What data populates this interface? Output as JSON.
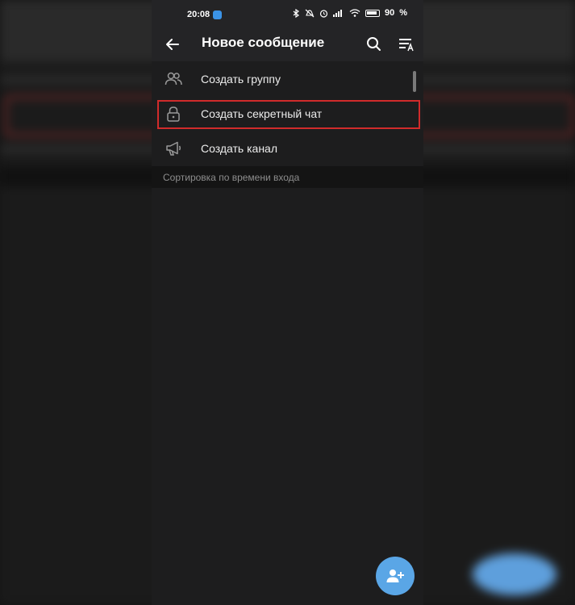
{
  "status_bar": {
    "time": "20:08",
    "battery": "90"
  },
  "app_bar": {
    "title": "Новое сообщение"
  },
  "menu": {
    "items": [
      {
        "label": "Создать группу",
        "icon": "people-icon"
      },
      {
        "label": "Создать секретный чат",
        "icon": "lock-icon"
      },
      {
        "label": "Создать канал",
        "icon": "megaphone-icon"
      }
    ]
  },
  "section": {
    "header": "Сортировка по времени входа"
  },
  "colors": {
    "accent": "#5aa6e6",
    "highlight": "#d12b2b",
    "background": "#1d1d1e"
  }
}
